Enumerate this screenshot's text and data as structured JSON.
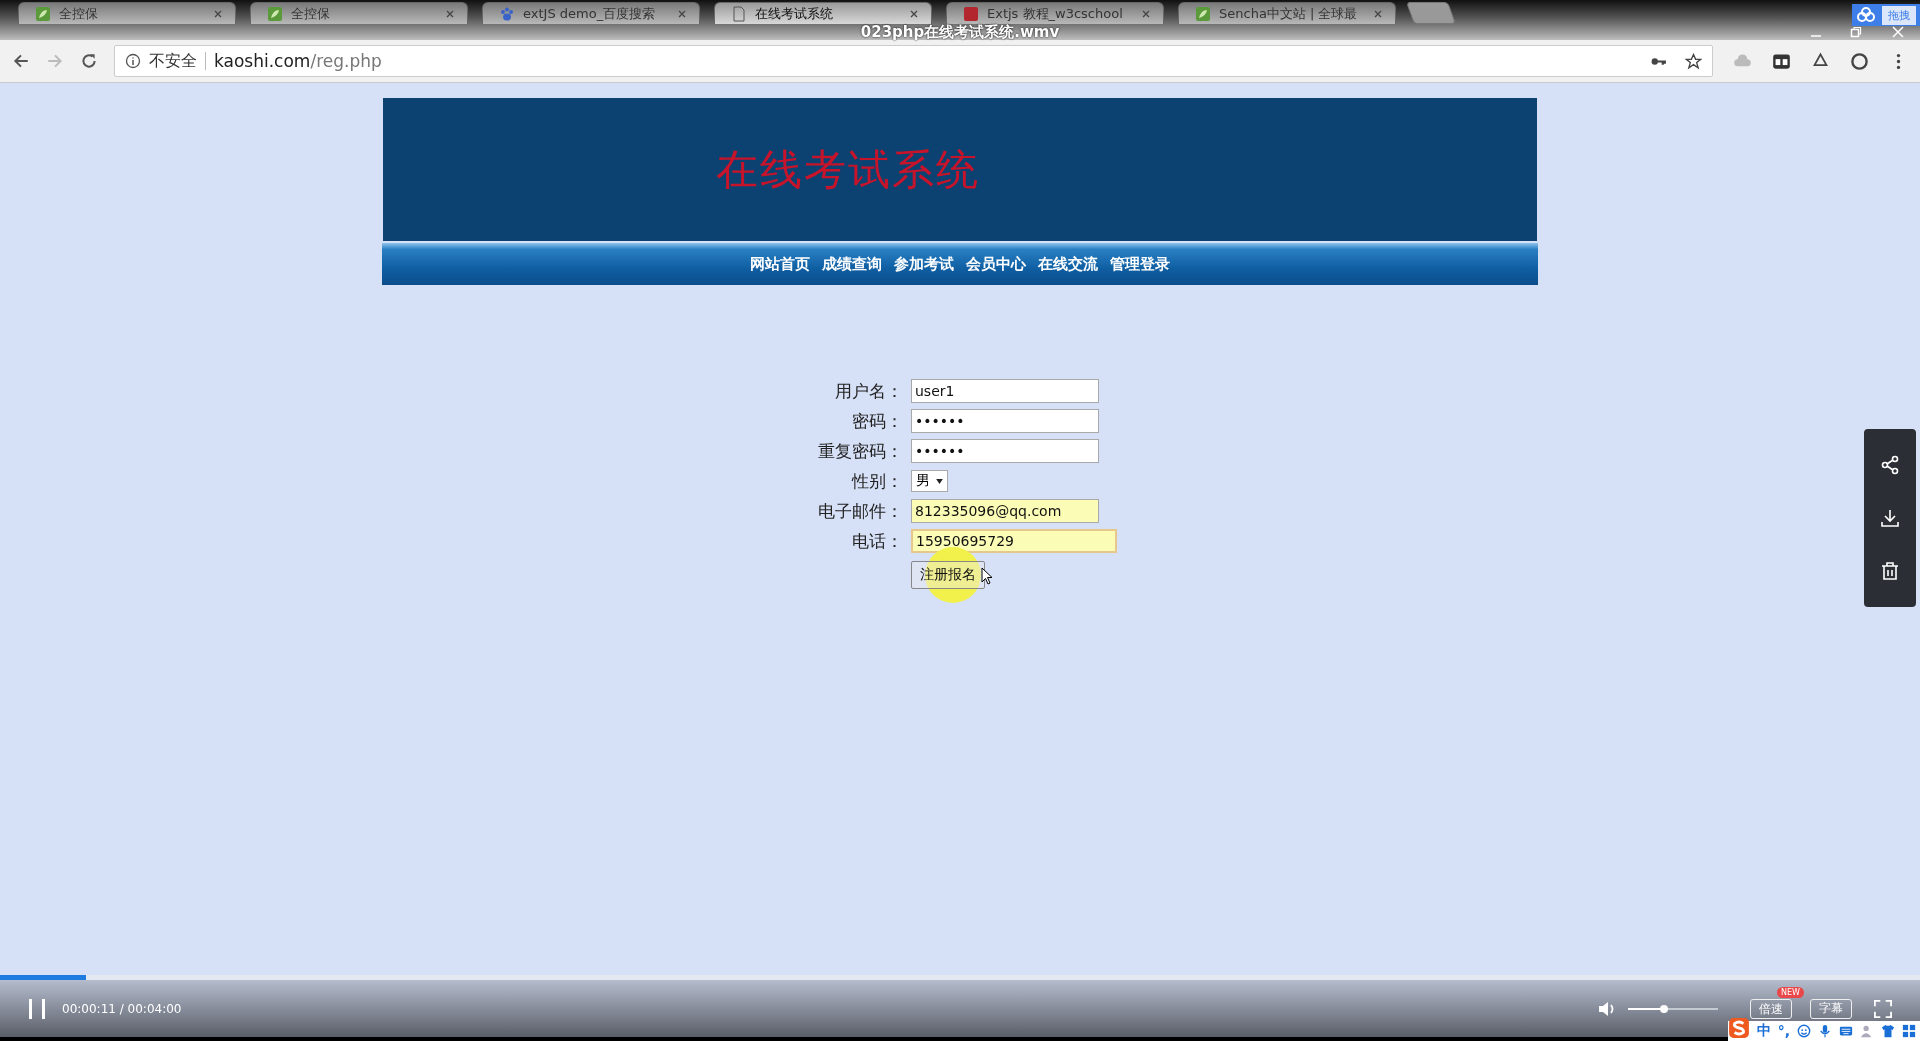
{
  "video": {
    "title": "023php在线考试系统.wmv",
    "drag_label": "拖拽"
  },
  "browser": {
    "tabs": [
      {
        "label": "全控保",
        "kind": "leaf",
        "selected": false
      },
      {
        "label": "全控保",
        "kind": "leaf",
        "selected": false
      },
      {
        "label": "extJS demo_百度搜索",
        "kind": "paw",
        "selected": false
      },
      {
        "label": "在线考试系统",
        "kind": "page",
        "selected": true
      },
      {
        "label": "Extjs 教程_w3cschool",
        "kind": "red",
        "selected": false
      },
      {
        "label": "Sencha中文站 | 全球最",
        "kind": "leaf",
        "selected": false
      }
    ],
    "security": "不安全",
    "url_host": "kaoshi.com",
    "url_path": "/reg.php"
  },
  "site": {
    "title": "在线考试系统",
    "nav": [
      "网站首页",
      "成绩查询",
      "参加考试",
      "会员中心",
      "在线交流",
      "管理登录"
    ],
    "form": [
      {
        "label": "用户名：",
        "kind": "text",
        "value": "user1",
        "autofilled": false
      },
      {
        "label": "密码：",
        "kind": "text",
        "value": "••••••",
        "autofilled": false
      },
      {
        "label": "重复密码：",
        "kind": "text",
        "value": "••••••",
        "autofilled": false
      },
      {
        "label": "性别：",
        "kind": "select",
        "value": "男",
        "autofilled": false
      },
      {
        "label": "电子邮件：",
        "kind": "text",
        "value": "812335096@qq.com",
        "autofilled": true
      },
      {
        "label": "电话：",
        "kind": "text",
        "value": "15950695729",
        "autofilled": true,
        "focused": true
      }
    ],
    "submit": "注册报名"
  },
  "player": {
    "progress": {
      "level": 0.045
    },
    "time": "00:00:11 / 00:04:00",
    "volume": {
      "level": 0.4
    },
    "speed": "倍速",
    "speed_badge": "NEW",
    "subtitles": "字幕"
  },
  "ime": {
    "mode": "中",
    "punct": "°,"
  }
}
